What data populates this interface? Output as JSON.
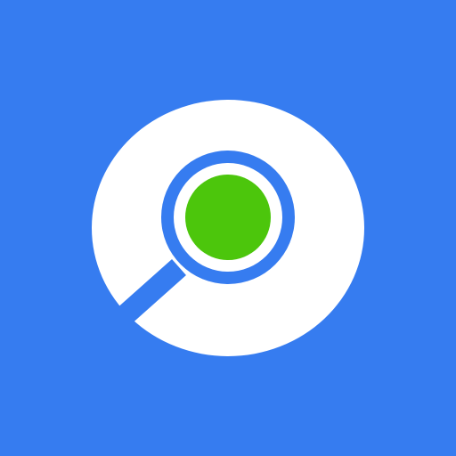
{
  "icon": {
    "name": "search-location-app-icon",
    "colors": {
      "background": "#367CF0",
      "ring": "#FFFFFF",
      "lens_rim": "#367CF0",
      "lens_center": "#4CC60C"
    }
  }
}
